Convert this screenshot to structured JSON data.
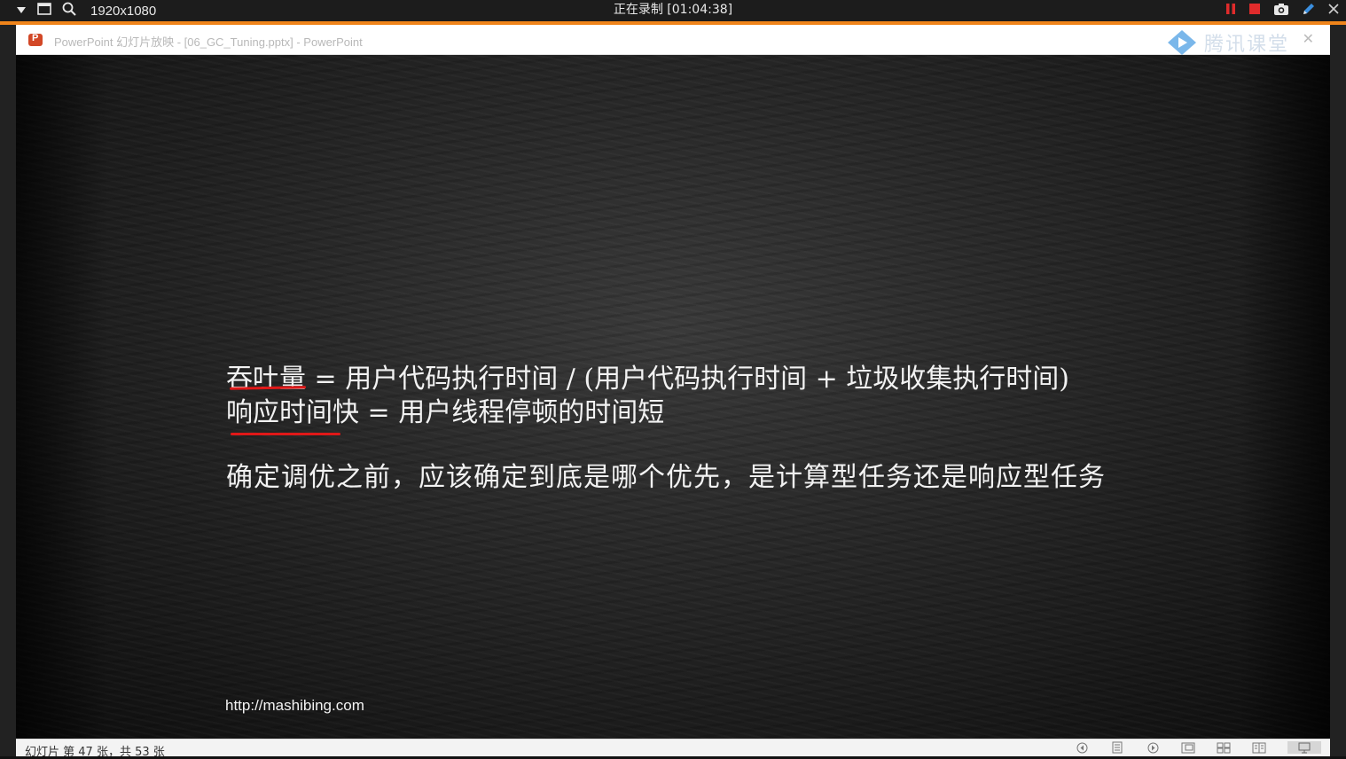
{
  "recorder": {
    "resolution": "1920x1080",
    "status": "正在录制 [01:04:38]"
  },
  "window": {
    "title": "PowerPoint 幻灯片放映 - [06_GC_Tuning.pptx] - PowerPoint",
    "watermark_text": "腾讯课堂"
  },
  "slide": {
    "line1": "吞吐量 = 用户代码执行时间 / (用户代码执行时间 + 垃圾收集执行时间)",
    "line2": "响应时间快 = 用户线程停顿的时间短",
    "line3": "确定调优之前，应该确定到底是哪个优先，是计算型任务还是响应型任务",
    "url": "http://mashibing.com"
  },
  "statusbar": {
    "slide_info": "幻灯片 第 47 张，共 53 张"
  },
  "colors": {
    "accent_orange": "#f0841a",
    "underline_red": "#e01818",
    "record_red": "#e02b2b"
  },
  "icons": [
    "dropdown-icon",
    "window-icon",
    "search-icon",
    "pause-icon",
    "stop-icon",
    "camera-icon",
    "pen-icon",
    "close-icon"
  ]
}
